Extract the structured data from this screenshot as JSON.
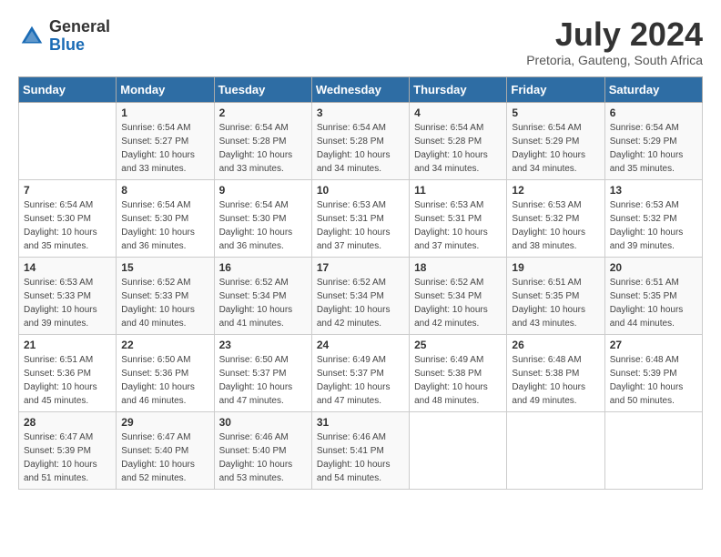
{
  "header": {
    "logo_general": "General",
    "logo_blue": "Blue",
    "title": "July 2024",
    "location": "Pretoria, Gauteng, South Africa"
  },
  "days_of_week": [
    "Sunday",
    "Monday",
    "Tuesday",
    "Wednesday",
    "Thursday",
    "Friday",
    "Saturday"
  ],
  "weeks": [
    [
      {
        "day": "",
        "info": ""
      },
      {
        "day": "1",
        "info": "Sunrise: 6:54 AM\nSunset: 5:27 PM\nDaylight: 10 hours\nand 33 minutes."
      },
      {
        "day": "2",
        "info": "Sunrise: 6:54 AM\nSunset: 5:28 PM\nDaylight: 10 hours\nand 33 minutes."
      },
      {
        "day": "3",
        "info": "Sunrise: 6:54 AM\nSunset: 5:28 PM\nDaylight: 10 hours\nand 34 minutes."
      },
      {
        "day": "4",
        "info": "Sunrise: 6:54 AM\nSunset: 5:28 PM\nDaylight: 10 hours\nand 34 minutes."
      },
      {
        "day": "5",
        "info": "Sunrise: 6:54 AM\nSunset: 5:29 PM\nDaylight: 10 hours\nand 34 minutes."
      },
      {
        "day": "6",
        "info": "Sunrise: 6:54 AM\nSunset: 5:29 PM\nDaylight: 10 hours\nand 35 minutes."
      }
    ],
    [
      {
        "day": "7",
        "info": "Sunrise: 6:54 AM\nSunset: 5:30 PM\nDaylight: 10 hours\nand 35 minutes."
      },
      {
        "day": "8",
        "info": "Sunrise: 6:54 AM\nSunset: 5:30 PM\nDaylight: 10 hours\nand 36 minutes."
      },
      {
        "day": "9",
        "info": "Sunrise: 6:54 AM\nSunset: 5:30 PM\nDaylight: 10 hours\nand 36 minutes."
      },
      {
        "day": "10",
        "info": "Sunrise: 6:53 AM\nSunset: 5:31 PM\nDaylight: 10 hours\nand 37 minutes."
      },
      {
        "day": "11",
        "info": "Sunrise: 6:53 AM\nSunset: 5:31 PM\nDaylight: 10 hours\nand 37 minutes."
      },
      {
        "day": "12",
        "info": "Sunrise: 6:53 AM\nSunset: 5:32 PM\nDaylight: 10 hours\nand 38 minutes."
      },
      {
        "day": "13",
        "info": "Sunrise: 6:53 AM\nSunset: 5:32 PM\nDaylight: 10 hours\nand 39 minutes."
      }
    ],
    [
      {
        "day": "14",
        "info": "Sunrise: 6:53 AM\nSunset: 5:33 PM\nDaylight: 10 hours\nand 39 minutes."
      },
      {
        "day": "15",
        "info": "Sunrise: 6:52 AM\nSunset: 5:33 PM\nDaylight: 10 hours\nand 40 minutes."
      },
      {
        "day": "16",
        "info": "Sunrise: 6:52 AM\nSunset: 5:34 PM\nDaylight: 10 hours\nand 41 minutes."
      },
      {
        "day": "17",
        "info": "Sunrise: 6:52 AM\nSunset: 5:34 PM\nDaylight: 10 hours\nand 42 minutes."
      },
      {
        "day": "18",
        "info": "Sunrise: 6:52 AM\nSunset: 5:34 PM\nDaylight: 10 hours\nand 42 minutes."
      },
      {
        "day": "19",
        "info": "Sunrise: 6:51 AM\nSunset: 5:35 PM\nDaylight: 10 hours\nand 43 minutes."
      },
      {
        "day": "20",
        "info": "Sunrise: 6:51 AM\nSunset: 5:35 PM\nDaylight: 10 hours\nand 44 minutes."
      }
    ],
    [
      {
        "day": "21",
        "info": "Sunrise: 6:51 AM\nSunset: 5:36 PM\nDaylight: 10 hours\nand 45 minutes."
      },
      {
        "day": "22",
        "info": "Sunrise: 6:50 AM\nSunset: 5:36 PM\nDaylight: 10 hours\nand 46 minutes."
      },
      {
        "day": "23",
        "info": "Sunrise: 6:50 AM\nSunset: 5:37 PM\nDaylight: 10 hours\nand 47 minutes."
      },
      {
        "day": "24",
        "info": "Sunrise: 6:49 AM\nSunset: 5:37 PM\nDaylight: 10 hours\nand 47 minutes."
      },
      {
        "day": "25",
        "info": "Sunrise: 6:49 AM\nSunset: 5:38 PM\nDaylight: 10 hours\nand 48 minutes."
      },
      {
        "day": "26",
        "info": "Sunrise: 6:48 AM\nSunset: 5:38 PM\nDaylight: 10 hours\nand 49 minutes."
      },
      {
        "day": "27",
        "info": "Sunrise: 6:48 AM\nSunset: 5:39 PM\nDaylight: 10 hours\nand 50 minutes."
      }
    ],
    [
      {
        "day": "28",
        "info": "Sunrise: 6:47 AM\nSunset: 5:39 PM\nDaylight: 10 hours\nand 51 minutes."
      },
      {
        "day": "29",
        "info": "Sunrise: 6:47 AM\nSunset: 5:40 PM\nDaylight: 10 hours\nand 52 minutes."
      },
      {
        "day": "30",
        "info": "Sunrise: 6:46 AM\nSunset: 5:40 PM\nDaylight: 10 hours\nand 53 minutes."
      },
      {
        "day": "31",
        "info": "Sunrise: 6:46 AM\nSunset: 5:41 PM\nDaylight: 10 hours\nand 54 minutes."
      },
      {
        "day": "",
        "info": ""
      },
      {
        "day": "",
        "info": ""
      },
      {
        "day": "",
        "info": ""
      }
    ]
  ]
}
